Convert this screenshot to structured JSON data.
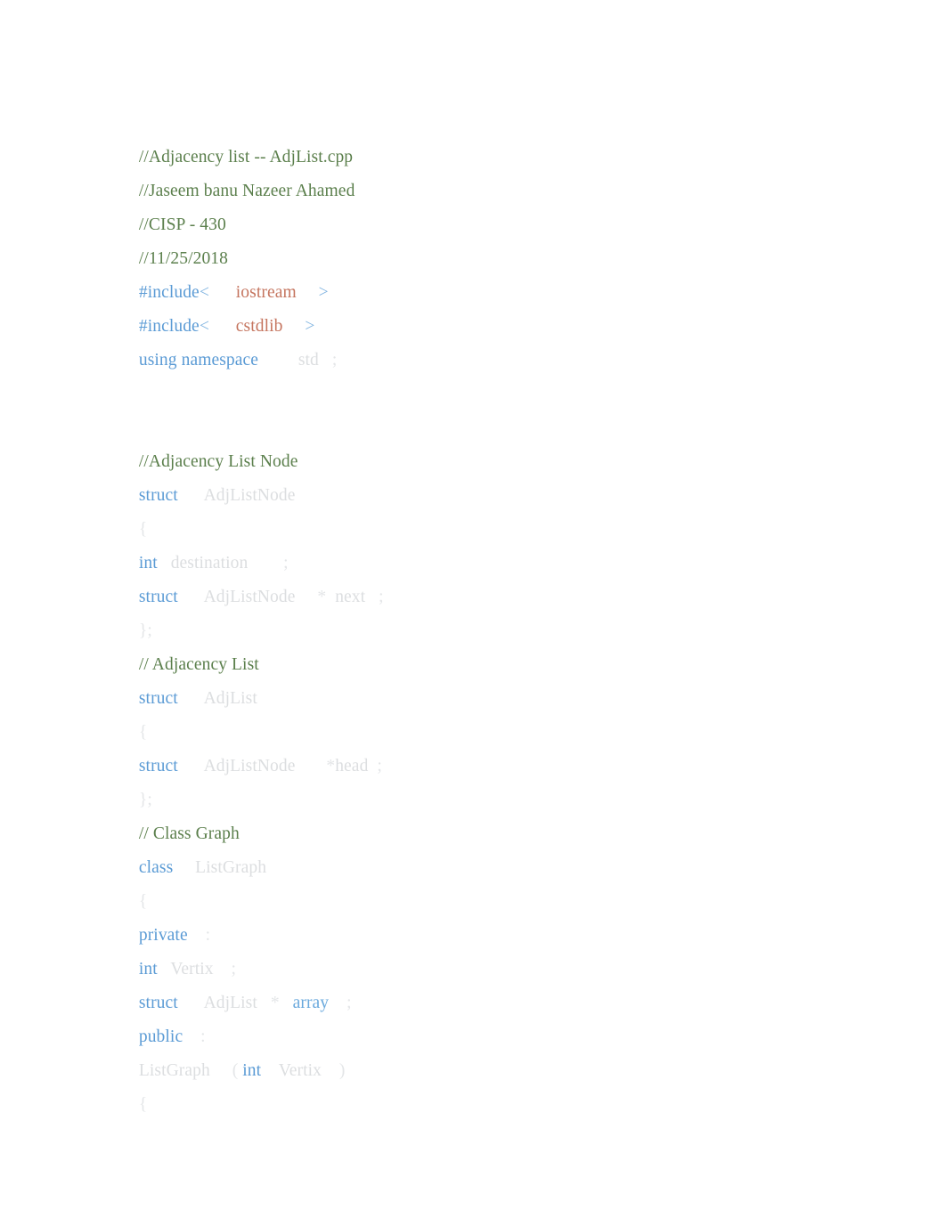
{
  "document": {
    "title": "AdjList.cpp",
    "language": "cpp",
    "colors": {
      "background": "#ffffff",
      "comment": "#5b7f4c",
      "keyword": "#5b9bd5",
      "header_string": "#c5755f",
      "identifier": "#dcdee0",
      "punctuation": "#e4e6e8",
      "variable": "#6aa9dd"
    }
  },
  "lines": [
    {
      "id": "l1",
      "text": "//Adjacency list -- AdjList.cpp"
    },
    {
      "id": "l2",
      "text": "//Jaseem banu Nazeer Ahamed"
    },
    {
      "id": "l3",
      "text": "//CISP - 430"
    },
    {
      "id": "l4",
      "text": "//11/25/2018"
    },
    {
      "id": "l5",
      "text": "#include <      iostream     >"
    },
    {
      "id": "l6",
      "text": "#include <      cstdlib     >"
    },
    {
      "id": "l7",
      "text": "using namespace         std   ;"
    },
    {
      "id": "l8",
      "text": ""
    },
    {
      "id": "l9",
      "text": ""
    },
    {
      "id": "l10",
      "text": "//Adjacency List Node"
    },
    {
      "id": "l11",
      "text": "struct      AdjListNode"
    },
    {
      "id": "l12",
      "text": "{"
    },
    {
      "id": "l13",
      "text": "int   destination        ;"
    },
    {
      "id": "l14",
      "text": "struct      AdjListNode     *  next   ;"
    },
    {
      "id": "l15",
      "text": "};"
    },
    {
      "id": "l16",
      "text": "// Adjacency List"
    },
    {
      "id": "l17",
      "text": "struct      AdjList"
    },
    {
      "id": "l18",
      "text": "{"
    },
    {
      "id": "l19",
      "text": "struct      AdjListNode       * head  ;"
    },
    {
      "id": "l20",
      "text": "};"
    },
    {
      "id": "l21",
      "text": "// Class Graph"
    },
    {
      "id": "l22",
      "text": "class     ListGraph"
    },
    {
      "id": "l23",
      "text": "{"
    },
    {
      "id": "l24",
      "text": "private    :"
    },
    {
      "id": "l25",
      "text": "int   Vertix    ;"
    },
    {
      "id": "l26",
      "text": "struct      AdjList   *   array    ;"
    },
    {
      "id": "l27",
      "text": "public    :"
    },
    {
      "id": "l28",
      "text": "ListGraph     (  int    Vertix    )"
    },
    {
      "id": "l29",
      "text": "{"
    }
  ],
  "tokens": {
    "l5": {
      "kw": "#include",
      "lt": "<",
      "hdr": "iostream",
      "gt": ">"
    },
    "l6": {
      "kw": "#include",
      "lt": "<",
      "hdr": "cstdlib",
      "gt": ">"
    },
    "l7": {
      "kw": "using namespace",
      "id": "std",
      "semi": ";"
    },
    "l11": {
      "kw": "struct",
      "id": "AdjListNode"
    },
    "l12": {
      "brace": "{"
    },
    "l13": {
      "kw": "int",
      "id": "destination",
      "semi": ";"
    },
    "l14": {
      "kw": "struct",
      "id": "AdjListNode",
      "star": "*",
      "id2": "next",
      "semi": ";"
    },
    "l15": {
      "brace": "};"
    },
    "l17": {
      "kw": "struct",
      "id": "AdjList"
    },
    "l18": {
      "brace": "{"
    },
    "l19": {
      "kw": "struct",
      "id": "AdjListNode",
      "star": "*",
      "id2": "head",
      "semi": ";"
    },
    "l20": {
      "brace": "};"
    },
    "l22": {
      "kw": "class",
      "id": "ListGraph"
    },
    "l23": {
      "brace": "{"
    },
    "l24": {
      "kw": "private",
      "colon": ":"
    },
    "l25": {
      "kw": "int",
      "id": "Vertix",
      "semi": ";"
    },
    "l26": {
      "kw": "struct",
      "id": "AdjList",
      "star": "*",
      "var": "array",
      "semi": ";"
    },
    "l27": {
      "kw": "public",
      "colon": ":"
    },
    "l28": {
      "id": "ListGraph",
      "lparen": "(",
      "kw": "int",
      "id2": "Vertix",
      "rparen": ")"
    },
    "l29": {
      "brace": "{"
    }
  }
}
